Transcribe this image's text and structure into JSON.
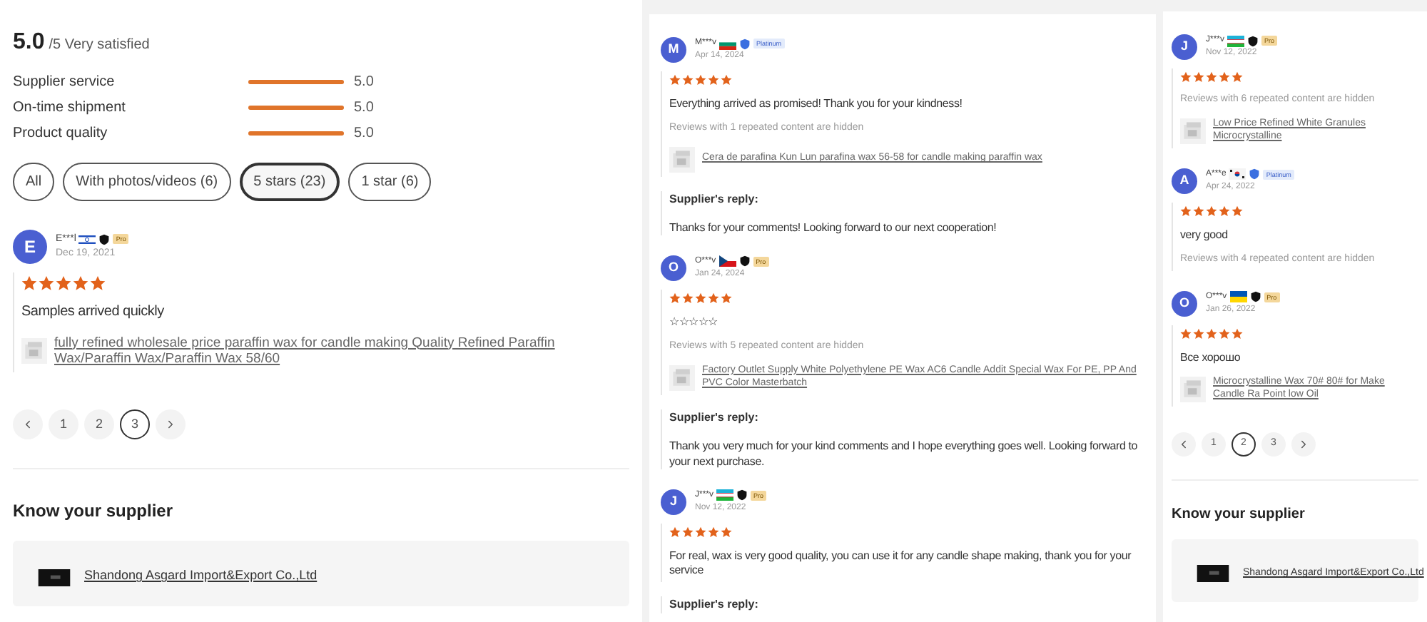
{
  "panels": [
    {
      "summary": {
        "score": "5.0",
        "suffix": "/5 Very satisfied",
        "metrics": [
          {
            "label": "Supplier service",
            "level": 1,
            "value": "5.0"
          },
          {
            "label": "On-time shipment",
            "level": 1,
            "value": "5.0"
          },
          {
            "label": "Product quality",
            "level": 1,
            "value": "5.0"
          }
        ]
      },
      "filters": [
        {
          "label": "All",
          "selected": false
        },
        {
          "label": "With photos/videos (6)",
          "selected": false
        },
        {
          "label": "5 stars (23)",
          "selected": true
        },
        {
          "label": "1 star (6)",
          "selected": false
        }
      ],
      "reviews": [
        {
          "initial": "E",
          "name": "E***l",
          "flag": {
            "kind": "israel"
          },
          "badge": {
            "kind": "pro",
            "label": "Pro"
          },
          "date": "Dec 19, 2021",
          "stars": 5,
          "text": "Samples arrived quickly",
          "product": "fully refined wholesale price paraffin wax for candle making Quality Refined Paraffin Wax/Paraffin Wax/Paraffin Wax 58/60"
        }
      ],
      "pagination": [
        {
          "label": "1",
          "selected": false
        },
        {
          "label": "2",
          "selected": false
        },
        {
          "label": "3",
          "selected": true
        }
      ],
      "supplier": {
        "heading": "Know your supplier",
        "company": "Shandong Asgard Import&Export Co.,Ltd"
      }
    },
    {
      "reviews": [
        {
          "initial": "M",
          "name": "M***v",
          "flag": {
            "kind": "bulgaria"
          },
          "badge": {
            "kind": "platinum",
            "label": "Platinum"
          },
          "date": "Apr 14, 2024",
          "stars": 5,
          "text": "Everything arrived as promised! Thank you for your kindness!",
          "note": "Reviews with 1 repeated content are hidden",
          "product": "Cera de parafina Kun Lun parafina wax 56-58 for candle making paraffin wax",
          "reply": {
            "heading": "Supplier's reply:",
            "text": "Thanks for your comments! Looking forward to our next cooperation!"
          }
        },
        {
          "initial": "O",
          "name": "O***v",
          "flag": {
            "kind": "czech"
          },
          "badge": {
            "kind": "pro",
            "label": "Pro"
          },
          "date": "Jan 24, 2024",
          "stars": 5,
          "text": "☆☆☆☆☆",
          "note": "Reviews with 5 repeated content are hidden",
          "product": "Factory Outlet Supply White Polyethylene PE Wax AC6 Candle Addit Special Wax For PE, PP And PVC Color Masterbatch",
          "reply": {
            "heading": "Supplier's reply:",
            "text": "Thank you very much for your kind comments and I hope everything goes well. Looking forward to your next purchase."
          }
        },
        {
          "initial": "J",
          "name": "J***v",
          "flag": {
            "kind": "uzbekistan"
          },
          "badge": {
            "kind": "pro",
            "label": "Pro"
          },
          "date": "Nov 12, 2022",
          "stars": 5,
          "text": "For real, wax is very good quality, you can use it for any candle shape making, thank you for your service",
          "reply": {
            "heading": "Supplier's reply:"
          }
        }
      ]
    },
    {
      "reviews": [
        {
          "initial": "J",
          "name": "J***v",
          "flag": {
            "kind": "uzbekistan"
          },
          "badge": {
            "kind": "pro",
            "label": "Pro"
          },
          "date": "Nov 12, 2022",
          "stars": 5,
          "note": "Reviews with 6 repeated content are hidden",
          "product": "Low Price Refined White Granules Microcrystalline"
        },
        {
          "initial": "A",
          "name": "A***e",
          "flag": {
            "kind": "korea"
          },
          "badge": {
            "kind": "platinum",
            "label": "Platinum"
          },
          "date": "Apr 24, 2022",
          "stars": 5,
          "text": "very good",
          "note": "Reviews with 4 repeated content are hidden"
        },
        {
          "initial": "O",
          "name": "O***v",
          "flag": {
            "kind": "ukraine"
          },
          "badge": {
            "kind": "pro",
            "label": "Pro"
          },
          "date": "Jan 26, 2022",
          "stars": 5,
          "text": "Все хорошо",
          "product": "Microcrystalline Wax 70# 80# for Make Candle Ra Point low Oil"
        }
      ],
      "pagination": [
        {
          "label": "1",
          "selected": false
        },
        {
          "label": "2",
          "selected": true
        },
        {
          "label": "3",
          "selected": false
        }
      ],
      "supplier": {
        "heading": "Know your supplier",
        "company": "Shandong Asgard Import&Export Co.,Ltd"
      }
    }
  ]
}
